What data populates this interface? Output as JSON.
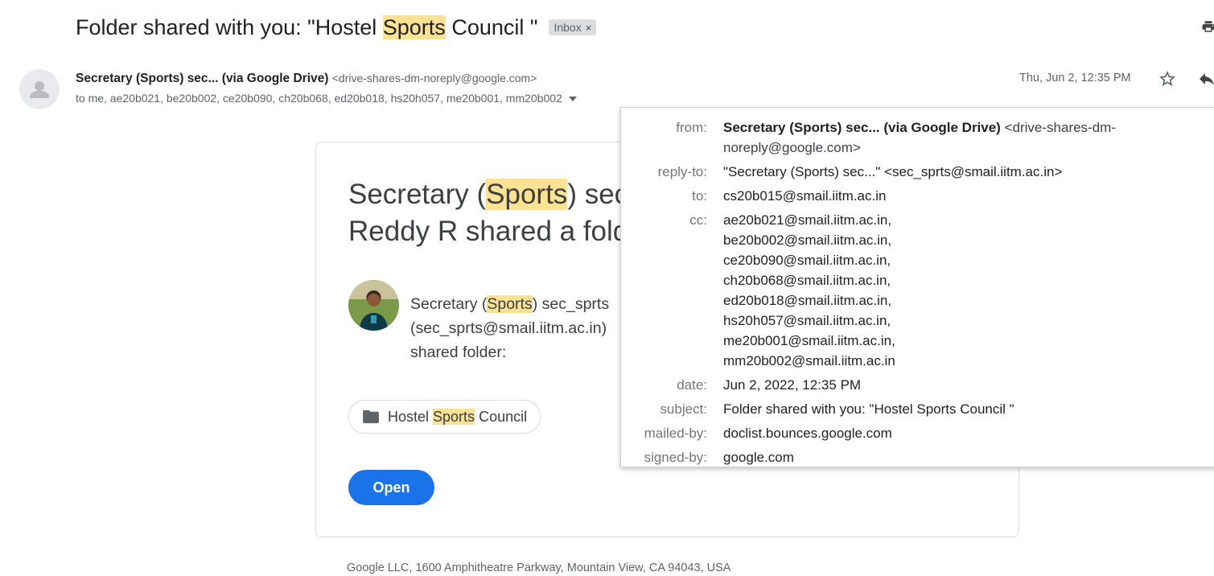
{
  "subject": {
    "prefix": "Folder shared with you: \"Hostel ",
    "highlight": "Sports",
    "suffix": " Council \"",
    "label_chip": "Inbox",
    "label_remove": "×"
  },
  "sender": {
    "name": "Secretary (Sports) sec... (via Google Drive)",
    "email": "<drive-shares-dm-noreply@google.com>",
    "to_line": "to me, ae20b021, be20b002, ce20b090, ch20b068, ed20b018, hs20h057, me20b001, mm20b002",
    "date": "Thu, Jun 2, 12:35 PM"
  },
  "card": {
    "title_line1_prefix": "Secretary (",
    "title_highlight": "Sports",
    "title_line1_suffix": ") sec",
    "title_line2": "Reddy R shared a fold",
    "share_line1_prefix": "Secretary (",
    "share_highlight": "Sports",
    "share_line1_suffix": ") sec_sprts",
    "share_line2": "(sec_sprts@smail.iitm.ac.in)",
    "share_line3": "shared folder:",
    "folder_prefix": "Hostel ",
    "folder_highlight": "Sports",
    "folder_suffix": " Council",
    "open_button": "Open"
  },
  "footer": "Google LLC, 1600 Amphitheatre Parkway, Mountain View, CA 94043, USA",
  "details": {
    "from_label": "from:",
    "from_name": "Secretary (Sports) sec... (via Google Drive)",
    "from_email_1": "<drive-shares-dm-",
    "from_email_2": "noreply@google.com>",
    "replyto_label": "reply-to:",
    "replyto_value": "\"Secretary (Sports) sec...\" <sec_sprts@smail.iitm.ac.in>",
    "to_label": "to:",
    "to_value": "cs20b015@smail.iitm.ac.in",
    "cc_label": "cc:",
    "cc": [
      "ae20b021@smail.iitm.ac.in,",
      "be20b002@smail.iitm.ac.in,",
      "ce20b090@smail.iitm.ac.in,",
      "ch20b068@smail.iitm.ac.in,",
      "ed20b018@smail.iitm.ac.in,",
      "hs20h057@smail.iitm.ac.in,",
      "me20b001@smail.iitm.ac.in,",
      "mm20b002@smail.iitm.ac.in"
    ],
    "date_label": "date:",
    "date_value": "Jun 2, 2022, 12:35 PM",
    "subject_label": "subject:",
    "subject_value": "Folder shared with you: \"Hostel Sports Council \"",
    "mailedby_label": "mailed-by:",
    "mailedby_value": "doclist.bounces.google.com",
    "signedby_label": "signed-by:",
    "signedby_value": "google.com"
  },
  "icons": {
    "print": "print-icon",
    "star": "star-icon",
    "reply": "reply-icon",
    "folder": "folder-icon",
    "avatar": "person-icon",
    "dropdown": "chevron-down-icon"
  },
  "colors": {
    "highlight": "#fde293",
    "open_button": "#1a73e8",
    "chip": "#dadce0"
  }
}
